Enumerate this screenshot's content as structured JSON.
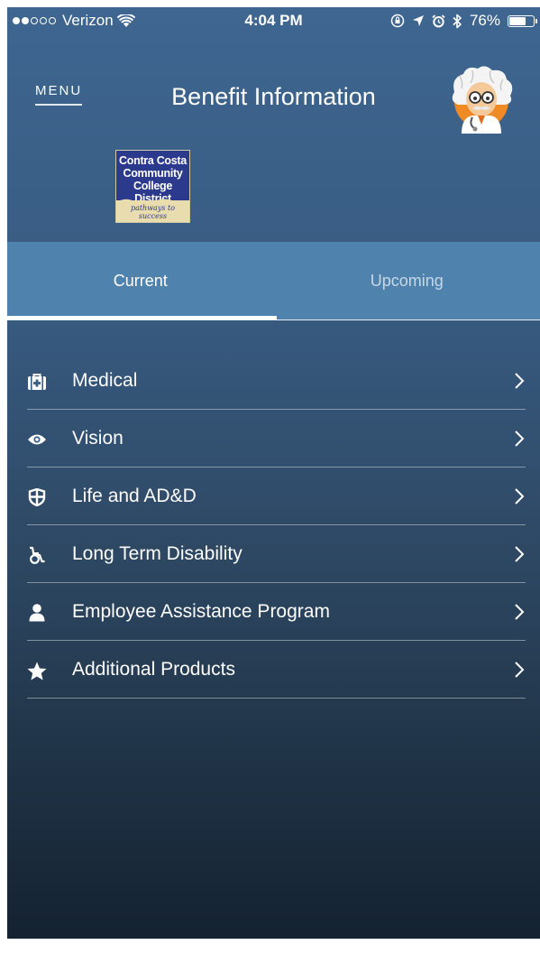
{
  "status_bar": {
    "carrier": "Verizon",
    "time": "4:04 PM",
    "battery_percent": "76%",
    "battery_level": 0.76,
    "signal_bars_filled": 2,
    "signal_bars_total": 5
  },
  "header": {
    "menu_label": "MENU",
    "title": "Benefit Information"
  },
  "logo": {
    "lines": [
      "Contra Costa",
      "Community",
      "College District"
    ],
    "tagline": "pathways to success"
  },
  "tabs": [
    {
      "label": "Current",
      "active": true
    },
    {
      "label": "Upcoming",
      "active": false
    }
  ],
  "benefits": [
    {
      "label": "Medical",
      "icon": "medical-kit-icon"
    },
    {
      "label": "Vision",
      "icon": "eye-icon"
    },
    {
      "label": "Life and AD&D",
      "icon": "shield-icon"
    },
    {
      "label": "Long Term Disability",
      "icon": "wheelchair-icon"
    },
    {
      "label": "Employee Assistance Program",
      "icon": "user-icon"
    },
    {
      "label": "Additional Products",
      "icon": "star-icon"
    }
  ],
  "colors": {
    "tab_bar": "#4f83ad",
    "background_top": "#3e6690",
    "background_bottom": "#142231",
    "logo_blue": "#2b3a8c",
    "logo_sand": "#e9dcae"
  }
}
